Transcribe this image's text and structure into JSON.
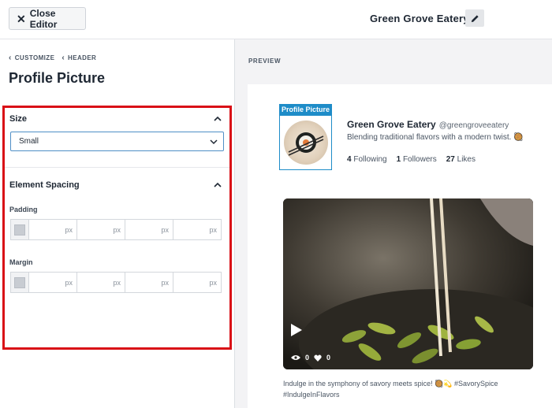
{
  "topbar": {
    "close_label": "Close Editor",
    "feed_name": "Green Grove Eatery"
  },
  "sidebar": {
    "breadcrumb": [
      "CUSTOMIZE",
      "HEADER"
    ],
    "title": "Profile Picture",
    "size": {
      "heading": "Size",
      "selected": "Small"
    },
    "spacing": {
      "heading": "Element Spacing",
      "padding_label": "Padding",
      "margin_label": "Margin",
      "unit": "px"
    }
  },
  "preview": {
    "label": "PREVIEW",
    "profile_tag": "Profile Picture",
    "account_name": "Green Grove Eatery",
    "handle": "@greengroveeatery",
    "bio": "Blending traditional flavors with a modern twist. 🥘",
    "stats": {
      "following_count": "4",
      "following_label": "Following",
      "followers_count": "1",
      "followers_label": "Followers",
      "likes_count": "27",
      "likes_label": "Likes"
    },
    "post": {
      "views": "0",
      "likes": "0",
      "caption": "Indulge in the symphony of savory meets spice! 🥘💫 #SavorySpice #IndulgeInFlavors"
    }
  },
  "colors": {
    "highlight_border": "#d90f16",
    "accent_blue": "#1e8cc8",
    "select_border": "#4f8fc6"
  }
}
